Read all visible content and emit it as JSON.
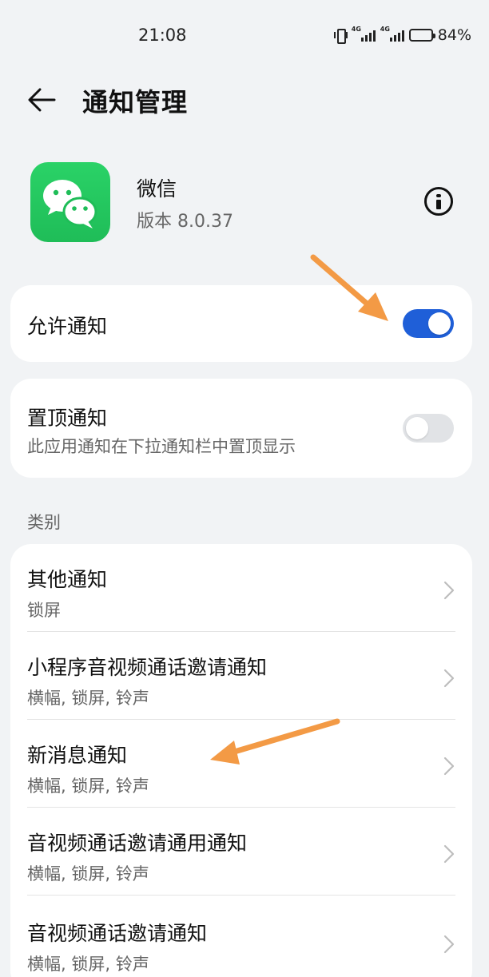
{
  "status_bar": {
    "time": "21:08",
    "network_1": "4G",
    "network_2": "4G",
    "battery": "84%",
    "battery_level": 0.84
  },
  "header": {
    "title": "通知管理",
    "back_icon": "arrow-left-icon"
  },
  "app": {
    "name": "微信",
    "version": "版本 8.0.37",
    "icon": "wechat-logo",
    "info_icon": "info-icon"
  },
  "allow_notifications": {
    "label": "允许通知",
    "enabled": true
  },
  "pinned_notifications": {
    "label": "置顶通知",
    "description": "此应用通知在下拉通知栏中置顶显示",
    "enabled": false
  },
  "categories": {
    "section_label": "类别",
    "items": [
      {
        "title": "其他通知",
        "subtitle": "锁屏"
      },
      {
        "title": "小程序音视频通话邀请通知",
        "subtitle": "横幅, 锁屏, 铃声"
      },
      {
        "title": "新消息通知",
        "subtitle": "横幅, 锁屏, 铃声"
      },
      {
        "title": "音视频通话邀请通用通知",
        "subtitle": "横幅, 锁屏, 铃声"
      },
      {
        "title": "音视频通话邀请通知",
        "subtitle": "横幅, 锁屏, 铃声"
      }
    ]
  },
  "colors": {
    "background": "#f1f3f5",
    "toggle_on": "#1f5fd8",
    "toggle_off": "#e1e3e6",
    "app_icon": "#22c55e",
    "annotation_arrow": "#f39a45"
  }
}
